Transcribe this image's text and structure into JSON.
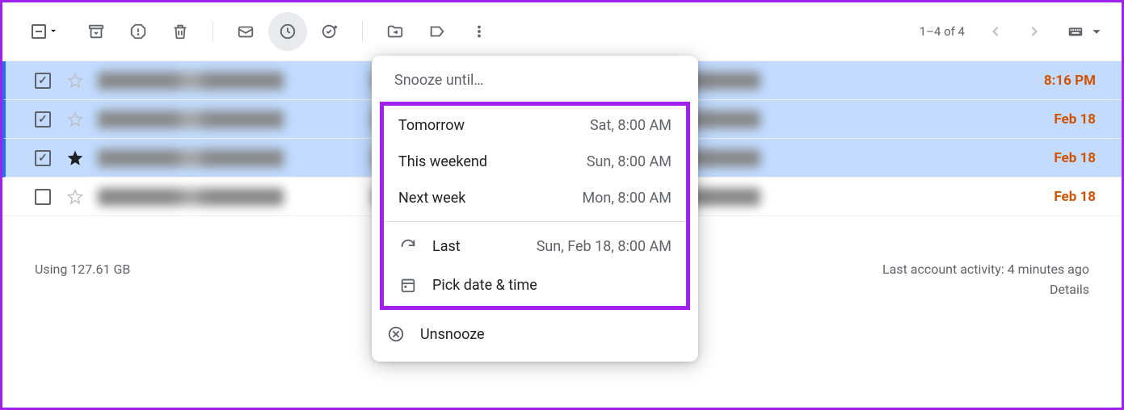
{
  "toolbar": {
    "pagination": "1–4 of 4"
  },
  "rows": [
    {
      "selected": true,
      "checked": true,
      "starred": false,
      "date": "8:16 PM",
      "is_time": true
    },
    {
      "selected": true,
      "checked": true,
      "starred": false,
      "date": "Feb 18",
      "is_time": false
    },
    {
      "selected": true,
      "checked": true,
      "starred": true,
      "date": "Feb 18",
      "is_time": false
    },
    {
      "selected": false,
      "checked": false,
      "starred": false,
      "date": "Feb 18",
      "is_time": false
    }
  ],
  "snooze": {
    "title": "Snooze until…",
    "options": [
      {
        "label": "Tomorrow",
        "value": "Sat, 8:00 AM"
      },
      {
        "label": "This weekend",
        "value": "Sun, 8:00 AM"
      },
      {
        "label": "Next week",
        "value": "Mon, 8:00 AM"
      }
    ],
    "last": {
      "label": "Last",
      "value": "Sun, Feb 18, 8:00 AM"
    },
    "pick": "Pick date & time",
    "unsnooze": "Unsnooze"
  },
  "footer": {
    "storage": "Using 127.61 GB",
    "activity": "Last account activity: 4 minutes ago",
    "details": "Details"
  }
}
